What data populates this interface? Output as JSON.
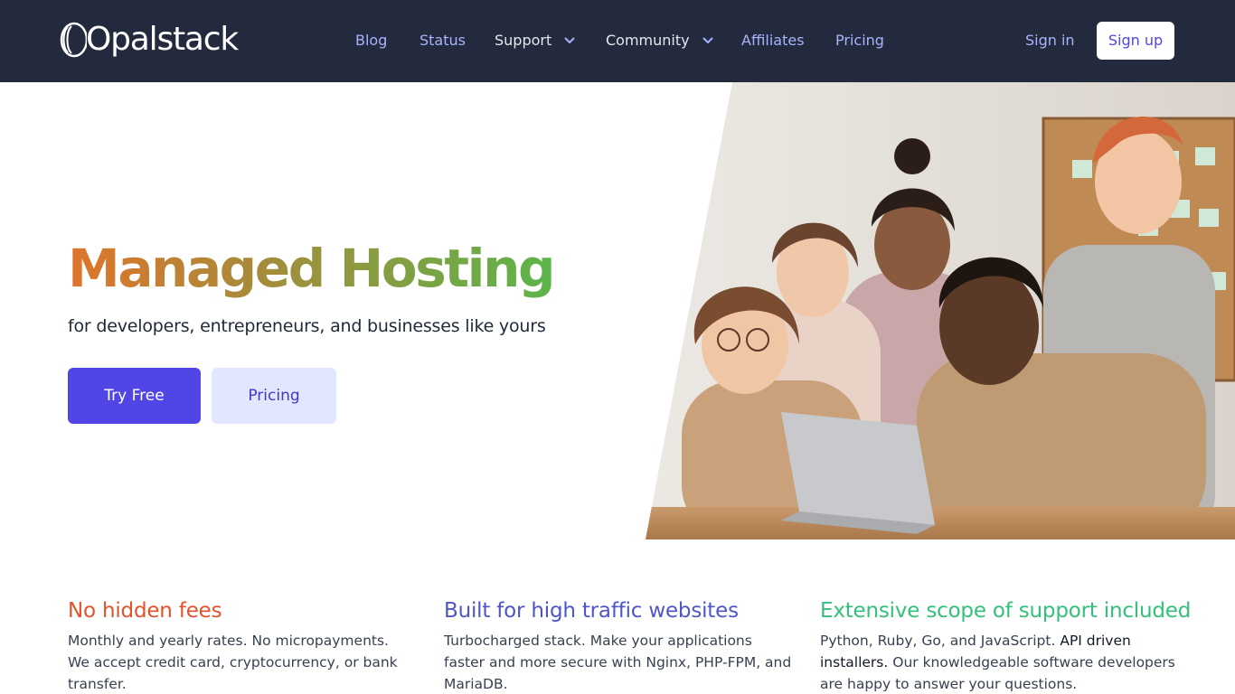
{
  "brand": {
    "name": "Opalstack"
  },
  "nav": {
    "blog": "Blog",
    "status": "Status",
    "support": "Support",
    "community": "Community",
    "affiliates": "Affiliates",
    "pricing": "Pricing",
    "sign_in": "Sign in",
    "sign_up": "Sign up"
  },
  "hero": {
    "title": "Managed Hosting",
    "subtitle": "for developers, entrepreneurs, and businesses like yours",
    "cta_primary": "Try Free",
    "cta_secondary": "Pricing"
  },
  "features": [
    {
      "title": "No hidden fees",
      "color": "#e0532b",
      "text": "Monthly and yearly rates. No micropayments. We accept credit card, cryptocurrency, or bank transfer."
    },
    {
      "title": "Built for high traffic websites",
      "color": "#4f56c9",
      "text": "Turbocharged stack. Make your applications faster and more secure with Nginx, PHP-FPM, and MariaDB."
    },
    {
      "title": "Extensive scope of support included",
      "color": "#34c07a",
      "text_pre": "Python, Ruby, Go, and JavaScript.",
      "text_highlight": "API driven installers.",
      "text_post": "Our knowledgeable software developers are happy to answer your questions."
    }
  ],
  "colors": {
    "nav_bg": "#232a3d",
    "nav_link": "#a5b4fc",
    "primary": "#4f46e5",
    "secondary_bg": "#e0e7ff"
  }
}
